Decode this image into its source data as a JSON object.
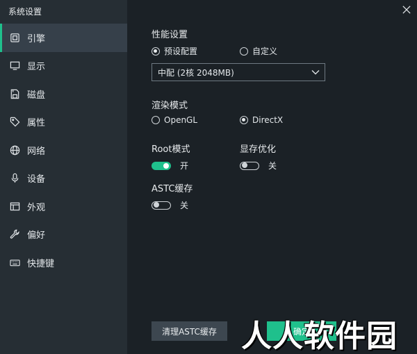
{
  "window": {
    "title": "系统设置"
  },
  "sidebar": {
    "items": [
      {
        "label": "引擎",
        "icon": "chip-icon",
        "active": true
      },
      {
        "label": "显示",
        "icon": "monitor-icon",
        "active": false
      },
      {
        "label": "磁盘",
        "icon": "disk-icon",
        "active": false
      },
      {
        "label": "属性",
        "icon": "tag-icon",
        "active": false
      },
      {
        "label": "网络",
        "icon": "globe-icon",
        "active": false
      },
      {
        "label": "设备",
        "icon": "microphone-icon",
        "active": false
      },
      {
        "label": "外观",
        "icon": "window-icon",
        "active": false
      },
      {
        "label": "偏好",
        "icon": "wrench-icon",
        "active": false
      },
      {
        "label": "快捷键",
        "icon": "keyboard-icon",
        "active": false
      }
    ]
  },
  "performance": {
    "title": "性能设置",
    "options": [
      {
        "label": "预设配置",
        "checked": true
      },
      {
        "label": "自定义",
        "checked": false
      }
    ],
    "select_value": "中配 (2核 2048MB)"
  },
  "render": {
    "title": "渲染模式",
    "options": [
      {
        "label": "OpenGL",
        "checked": false
      },
      {
        "label": "DirectX",
        "checked": true
      }
    ]
  },
  "root": {
    "title": "Root模式",
    "state": "开",
    "on": true
  },
  "gpu_opt": {
    "title": "显存优化",
    "state": "关",
    "on": false
  },
  "astc": {
    "title": "ASTC缓存",
    "state": "关",
    "on": false
  },
  "buttons": {
    "clear_astc": "清理ASTC缓存",
    "confirm": "确定"
  },
  "watermark": "人人软件园",
  "colors": {
    "accent": "#1fc08c",
    "sidebar_bg": "#262e34",
    "content_bg": "#1b2126",
    "active_item_bg": "#36404a"
  }
}
